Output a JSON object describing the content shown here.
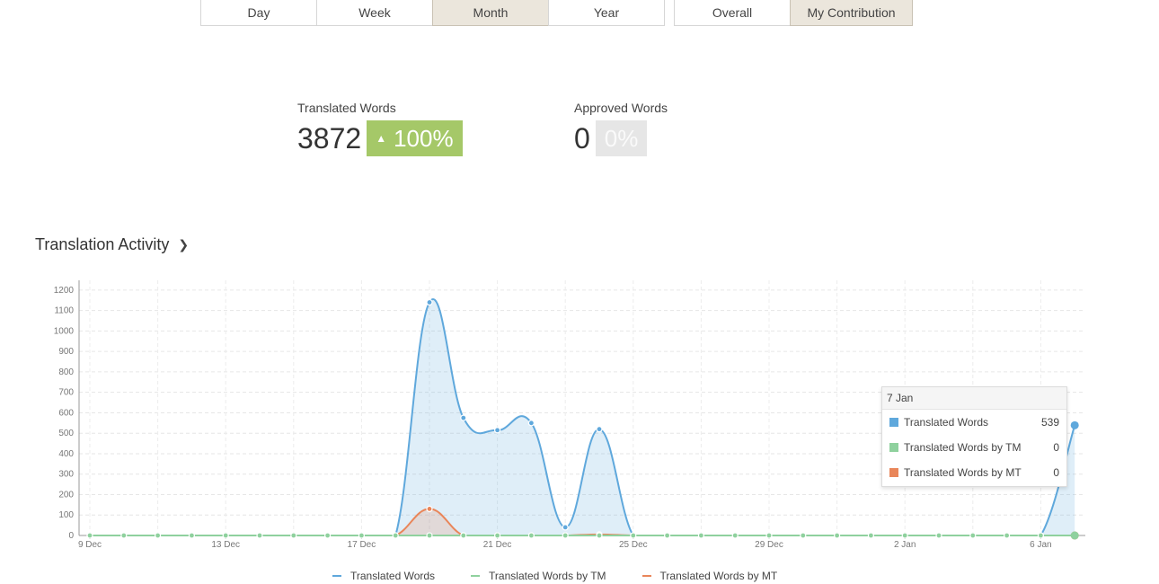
{
  "tabs": {
    "period": [
      {
        "label": "Day",
        "active": false
      },
      {
        "label": "Week",
        "active": false
      },
      {
        "label": "Month",
        "active": true
      },
      {
        "label": "Year",
        "active": false
      }
    ],
    "scope": [
      {
        "label": "Overall",
        "active": false
      },
      {
        "label": "My Contribution",
        "active": true
      }
    ]
  },
  "stats": {
    "translated": {
      "label": "Translated Words",
      "value": "3872",
      "change": "100%",
      "trend": "up"
    },
    "approved": {
      "label": "Approved Words",
      "value": "0",
      "change": "0%"
    }
  },
  "section": {
    "title": "Translation Activity"
  },
  "colors": {
    "translated": "#5fa8dc",
    "tm": "#8fd19e",
    "mt": "#e9865a",
    "badge_up": "#a5c868",
    "tab_active": "#ebe6dc"
  },
  "tooltip": {
    "date": "7 Jan",
    "rows": [
      {
        "name": "Translated Words",
        "value": "539",
        "color": "#5fa8dc"
      },
      {
        "name": "Translated Words by TM",
        "value": "0",
        "color": "#8fd19e"
      },
      {
        "name": "Translated Words by MT",
        "value": "0",
        "color": "#e9865a"
      }
    ]
  },
  "chart_data": {
    "type": "area",
    "x_tick_labels": [
      "9 Dec",
      "13 Dec",
      "17 Dec",
      "21 Dec",
      "25 Dec",
      "29 Dec",
      "2 Jan",
      "6 Jan"
    ],
    "x": [
      "9 Dec",
      "10 Dec",
      "11 Dec",
      "12 Dec",
      "13 Dec",
      "14 Dec",
      "15 Dec",
      "16 Dec",
      "17 Dec",
      "18 Dec",
      "19 Dec",
      "20 Dec",
      "21 Dec",
      "22 Dec",
      "23 Dec",
      "24 Dec",
      "25 Dec",
      "26 Dec",
      "27 Dec",
      "28 Dec",
      "29 Dec",
      "30 Dec",
      "31 Dec",
      "1 Jan",
      "2 Jan",
      "3 Jan",
      "4 Jan",
      "5 Jan",
      "6 Jan",
      "7 Jan"
    ],
    "series": [
      {
        "name": "Translated Words",
        "color": "#5fa8dc",
        "values": [
          0,
          0,
          0,
          0,
          0,
          0,
          0,
          0,
          0,
          0,
          1140,
          575,
          515,
          550,
          40,
          520,
          0,
          0,
          0,
          0,
          0,
          0,
          0,
          0,
          0,
          0,
          0,
          0,
          0,
          539
        ]
      },
      {
        "name": "Translated Words by TM",
        "color": "#8fd19e",
        "values": [
          0,
          0,
          0,
          0,
          0,
          0,
          0,
          0,
          0,
          0,
          0,
          0,
          0,
          0,
          0,
          0,
          0,
          0,
          0,
          0,
          0,
          0,
          0,
          0,
          0,
          0,
          0,
          0,
          0,
          0
        ]
      },
      {
        "name": "Translated Words by MT",
        "color": "#e9865a",
        "values": [
          0,
          0,
          0,
          0,
          0,
          0,
          0,
          0,
          0,
          0,
          130,
          0,
          0,
          0,
          0,
          5,
          0,
          0,
          0,
          0,
          0,
          0,
          0,
          0,
          0,
          0,
          0,
          0,
          0,
          0
        ]
      }
    ],
    "ylim": [
      0,
      1250
    ],
    "yticks": [
      0,
      100,
      200,
      300,
      400,
      500,
      600,
      700,
      800,
      900,
      1000,
      1100,
      1200
    ],
    "grid": true,
    "legend": "bottom"
  }
}
